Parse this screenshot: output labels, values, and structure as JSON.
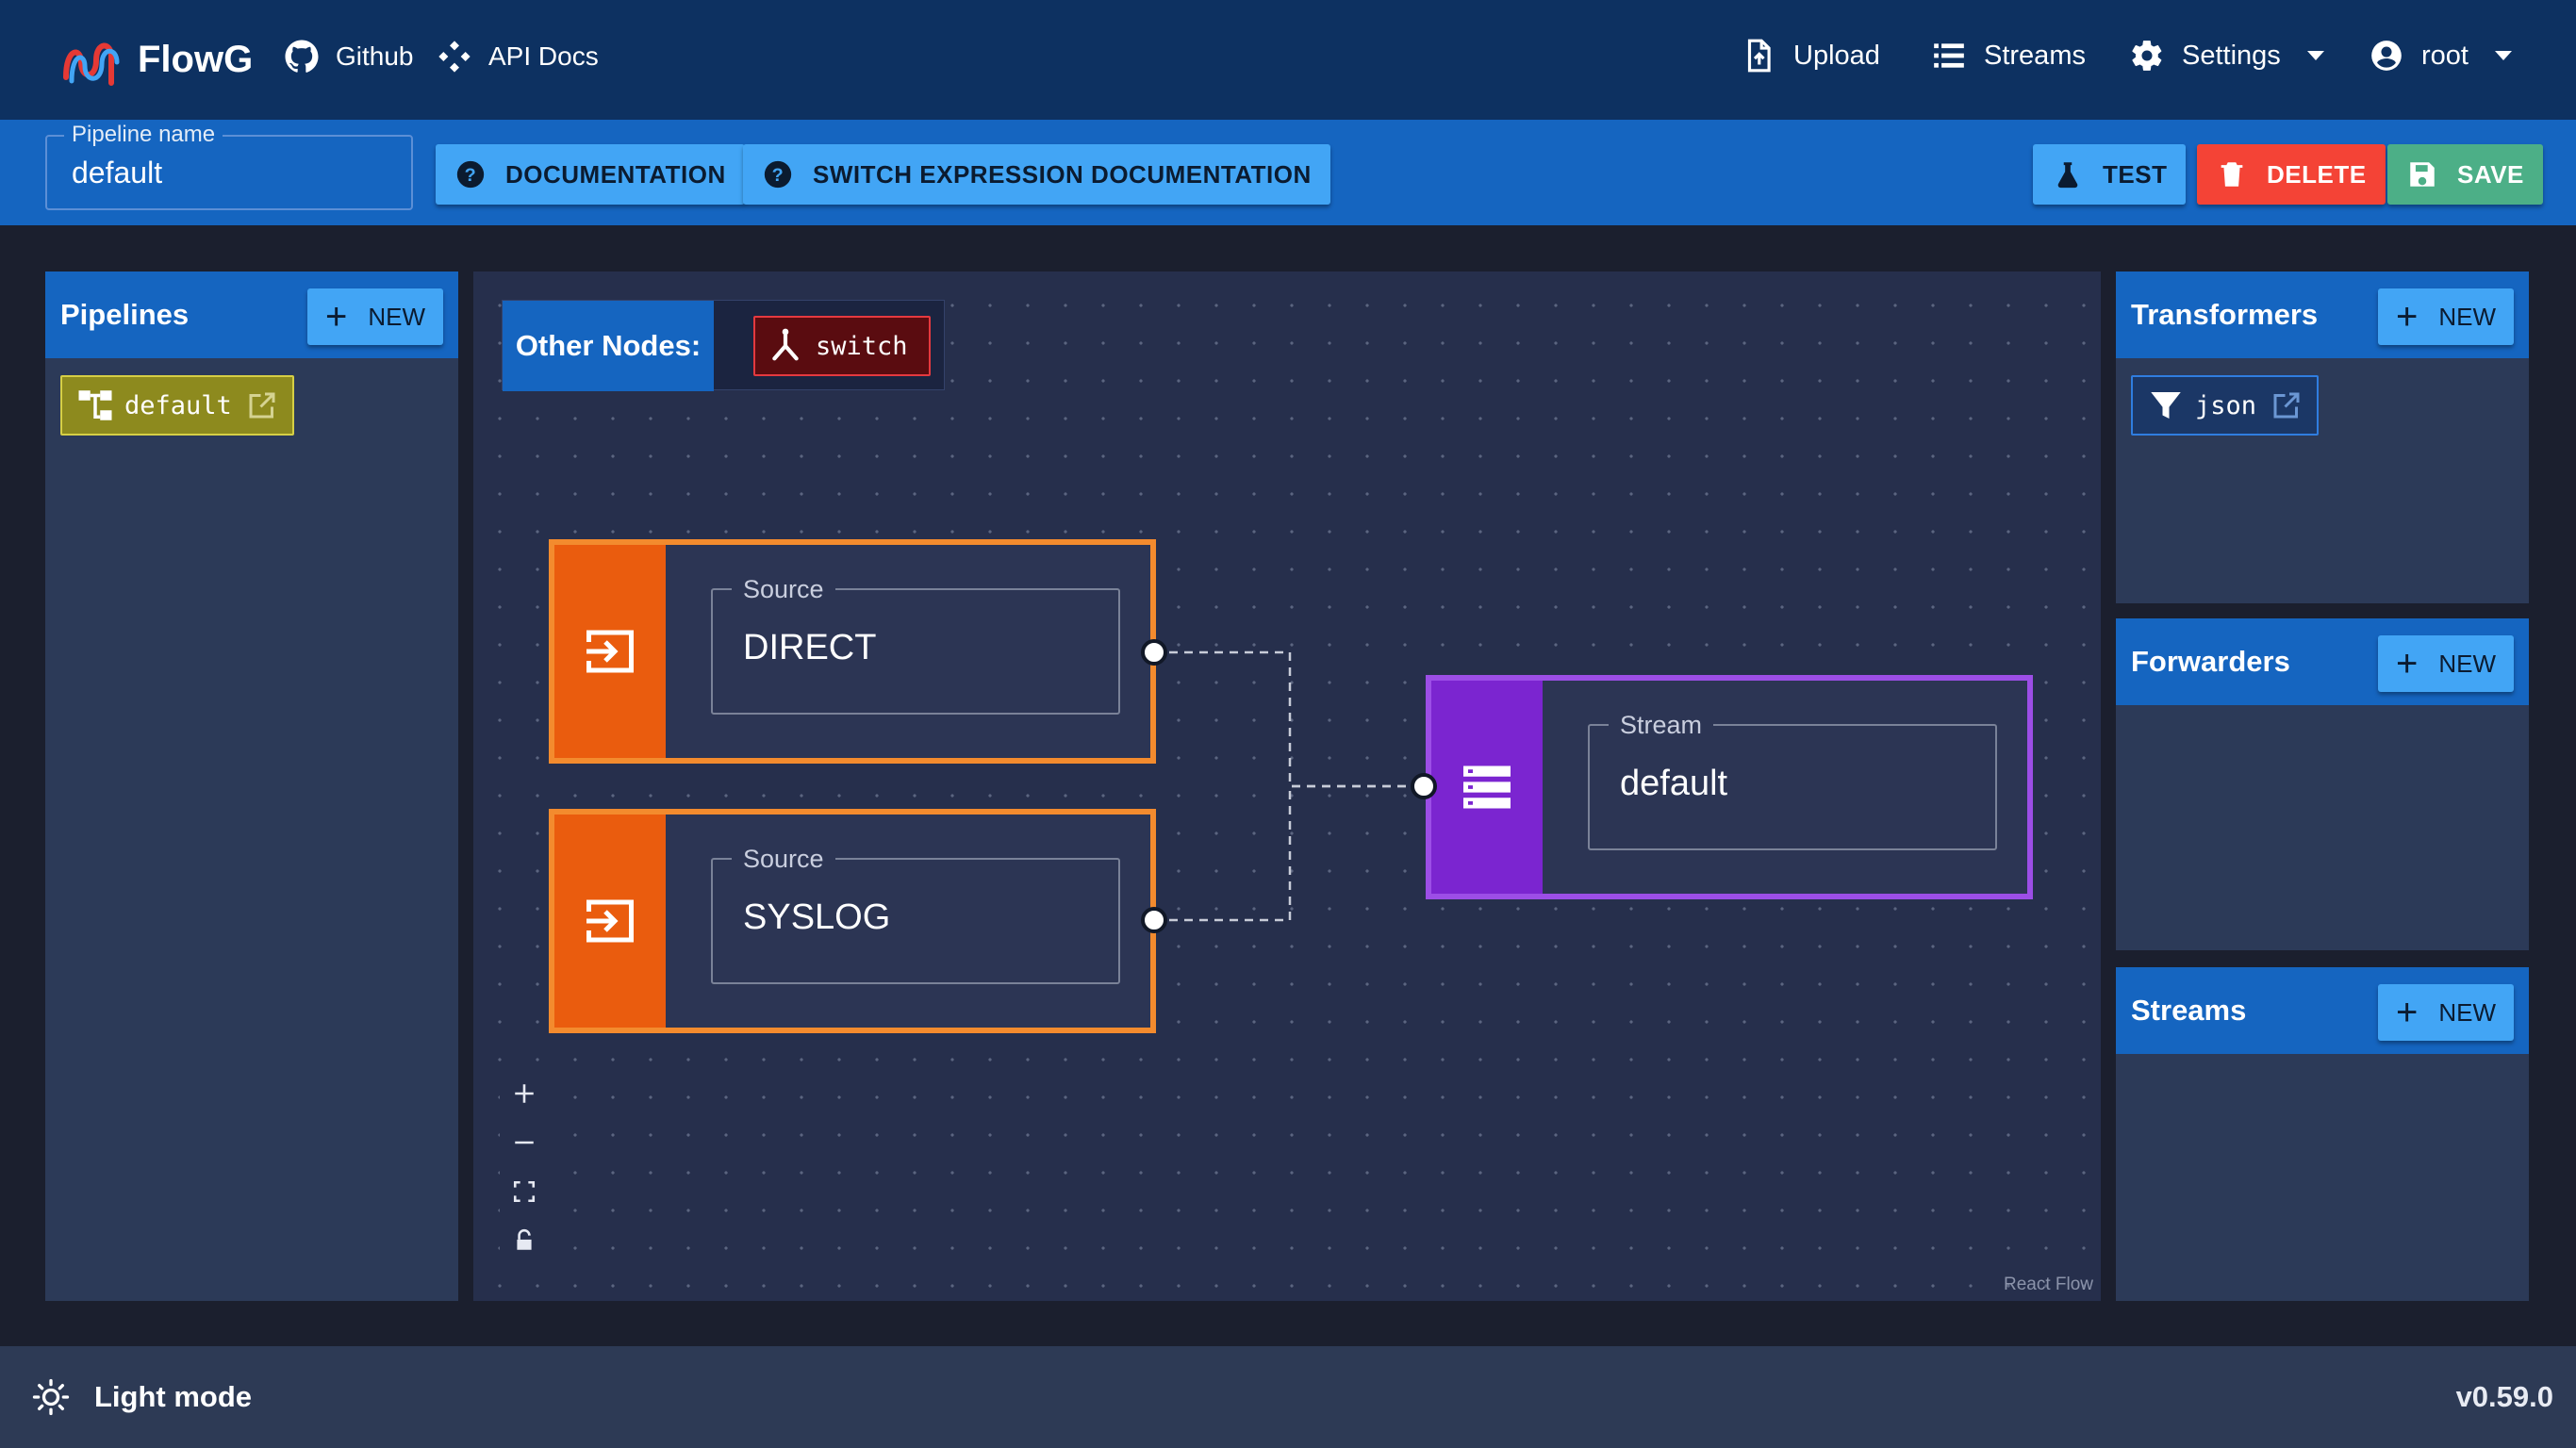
{
  "navbar": {
    "brand": "FlowG",
    "links": [
      {
        "label": "Github",
        "icon": "github-icon"
      },
      {
        "label": "API Docs",
        "icon": "api-docs-icon"
      }
    ],
    "upload_label": "Upload",
    "streams_label": "Streams",
    "settings_label": "Settings",
    "user_label": "root"
  },
  "toolbar": {
    "pipeline_name_label": "Pipeline name",
    "pipeline_name_value": "default",
    "documentation_label": "DOCUMENTATION",
    "switch_doc_label": "SWITCH EXPRESSION DOCUMENTATION",
    "test_label": "TEST",
    "delete_label": "DELETE",
    "save_label": "SAVE"
  },
  "pipelines": {
    "title": "Pipelines",
    "new_label": "NEW",
    "items": [
      {
        "label": "default"
      }
    ]
  },
  "transformers": {
    "title": "Transformers",
    "new_label": "NEW",
    "items": [
      {
        "label": "json"
      }
    ]
  },
  "forwarders": {
    "title": "Forwarders",
    "new_label": "NEW"
  },
  "streams_panel": {
    "title": "Streams",
    "new_label": "NEW"
  },
  "canvas": {
    "other_nodes_label": "Other Nodes:",
    "switch_label": "switch",
    "nodes": [
      {
        "kind": "Source",
        "value": "DIRECT"
      },
      {
        "kind": "Source",
        "value": "SYSLOG"
      },
      {
        "kind": "Stream",
        "value": "default"
      }
    ],
    "controls": [
      "zoom-in",
      "zoom-out",
      "fit-view",
      "lock"
    ],
    "attribution": "React Flow"
  },
  "footer": {
    "theme_label": "Light mode",
    "version": "v0.59.0"
  },
  "colors": {
    "navbar": "#0d3161",
    "toolbar": "#1565c0",
    "accent_button": "#42a5f5",
    "delete": "#f44336",
    "save": "#4caf87",
    "source_border": "#f38b2e",
    "source_band": "#ea5c0e",
    "stream_border": "#9c4ee6",
    "stream_band": "#7b25d0",
    "switch_chip": "#5a0c10"
  }
}
